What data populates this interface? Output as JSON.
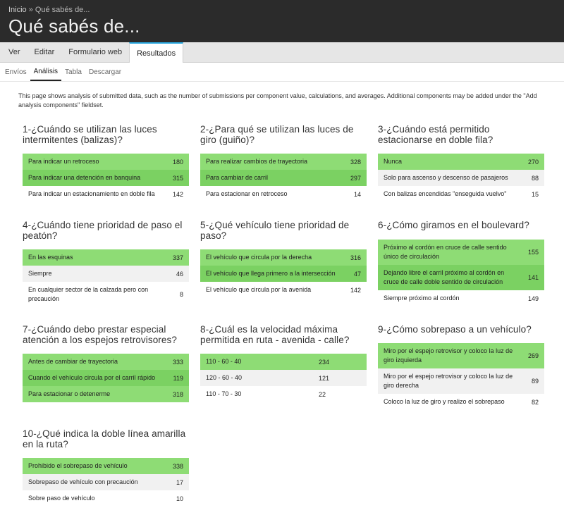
{
  "breadcrumb": {
    "home": "Inicio",
    "separator": "»",
    "current": "Qué sabés de..."
  },
  "title": "Qué sabés de...",
  "primary_tabs": [
    "Ver",
    "Editar",
    "Formulario web",
    "Resultados"
  ],
  "secondary_tabs": [
    "Envíos",
    "Análisis",
    "Tabla",
    "Descargar"
  ],
  "intro": "This page shows analysis of submitted data, such as the number of submissions per component value, calculations, and averages. Additional components may be added under the \"Add analysis components\" fieldset.",
  "questions": [
    {
      "title": "1-¿Cuándo se utilizan las luces intermitentes (balizas)?",
      "rows": [
        {
          "label": "Para indicar un retroceso",
          "count": "180"
        },
        {
          "label": "Para indicar una detención en banquina",
          "count": "315"
        },
        {
          "label": "Para indicar un estacionamiento en doble fila",
          "count": "142"
        }
      ]
    },
    {
      "title": "2-¿Para qué se utilizan las luces de giro (guiño)?",
      "rows": [
        {
          "label": "Para realizar cambios de trayectoria",
          "count": "328"
        },
        {
          "label": "Para cambiar de carril",
          "count": "297"
        },
        {
          "label": "Para estacionar en retroceso",
          "count": "14"
        }
      ]
    },
    {
      "title": "3-¿Cuándo está permitido estacionarse en doble fila?",
      "rows": [
        {
          "label": "Nunca",
          "count": "270"
        },
        {
          "label": "Solo para ascenso y descenso de pasajeros",
          "count": "88"
        },
        {
          "label": "Con balizas encendidas \"enseguida vuelvo\"",
          "count": "15"
        }
      ]
    },
    {
      "title": "4-¿Cuándo tiene prioridad de paso el peatón?",
      "rows": [
        {
          "label": "En las esquinas",
          "count": "337"
        },
        {
          "label": "Siempre",
          "count": "46"
        },
        {
          "label": "En cualquier sector de la calzada pero con precaución",
          "count": "8"
        }
      ]
    },
    {
      "title": "5-¿Qué vehículo tiene prioridad de paso?",
      "rows": [
        {
          "label": "El vehículo que circula por la derecha",
          "count": "316"
        },
        {
          "label": "El vehículo que llega primero a la intersección",
          "count": "47"
        },
        {
          "label": "El vehículo que circula por la avenida",
          "count": "142"
        }
      ]
    },
    {
      "title": "6-¿Cómo giramos en el boulevard?",
      "rows": [
        {
          "label": "Próximo al cordón en cruce de calle sentido único de circulación",
          "count": "155"
        },
        {
          "label": "Dejando libre el carril próximo al cordón en cruce de calle doble sentido de circulación",
          "count": "141"
        },
        {
          "label": "Siempre próximo al cordón",
          "count": "149"
        }
      ]
    },
    {
      "title": "7-¿Cuándo debo prestar especial atención a los espejos retrovisores?",
      "rows": [
        {
          "label": "Antes de cambiar de trayectoria",
          "count": "333"
        },
        {
          "label": "Cuando el vehículo circula por el carril rápido",
          "count": "119"
        },
        {
          "label": "Para estacionar o detenerme",
          "count": "318"
        }
      ]
    },
    {
      "title": "8-¿Cuál es la velocidad máxima permitida en ruta - avenida - calle?",
      "rows": [
        {
          "label": "110 - 60 - 40",
          "count": "234"
        },
        {
          "label": "120 - 60 - 40",
          "count": "121"
        },
        {
          "label": "110 - 70 - 30",
          "count": "22"
        }
      ]
    },
    {
      "title": "9-¿Cómo sobrepaso a un vehículo?",
      "rows": [
        {
          "label": "Miro por el espejo retrovisor y coloco la luz de giro izquierda",
          "count": "269"
        },
        {
          "label": "Miro por el espejo retrovisor y coloco la luz de giro derecha",
          "count": "89"
        },
        {
          "label": "Coloco la luz de giro y realizo el sobrepaso",
          "count": "82"
        }
      ]
    },
    {
      "title": "10-¿Qué indica la doble línea amarilla en la ruta?",
      "rows": [
        {
          "label": "Prohibido el sobrepaso de vehículo",
          "count": "338"
        },
        {
          "label": "Sobrepaso de vehículo con precaución",
          "count": "17"
        },
        {
          "label": "Sobre paso de vehículo",
          "count": "10"
        }
      ]
    }
  ]
}
